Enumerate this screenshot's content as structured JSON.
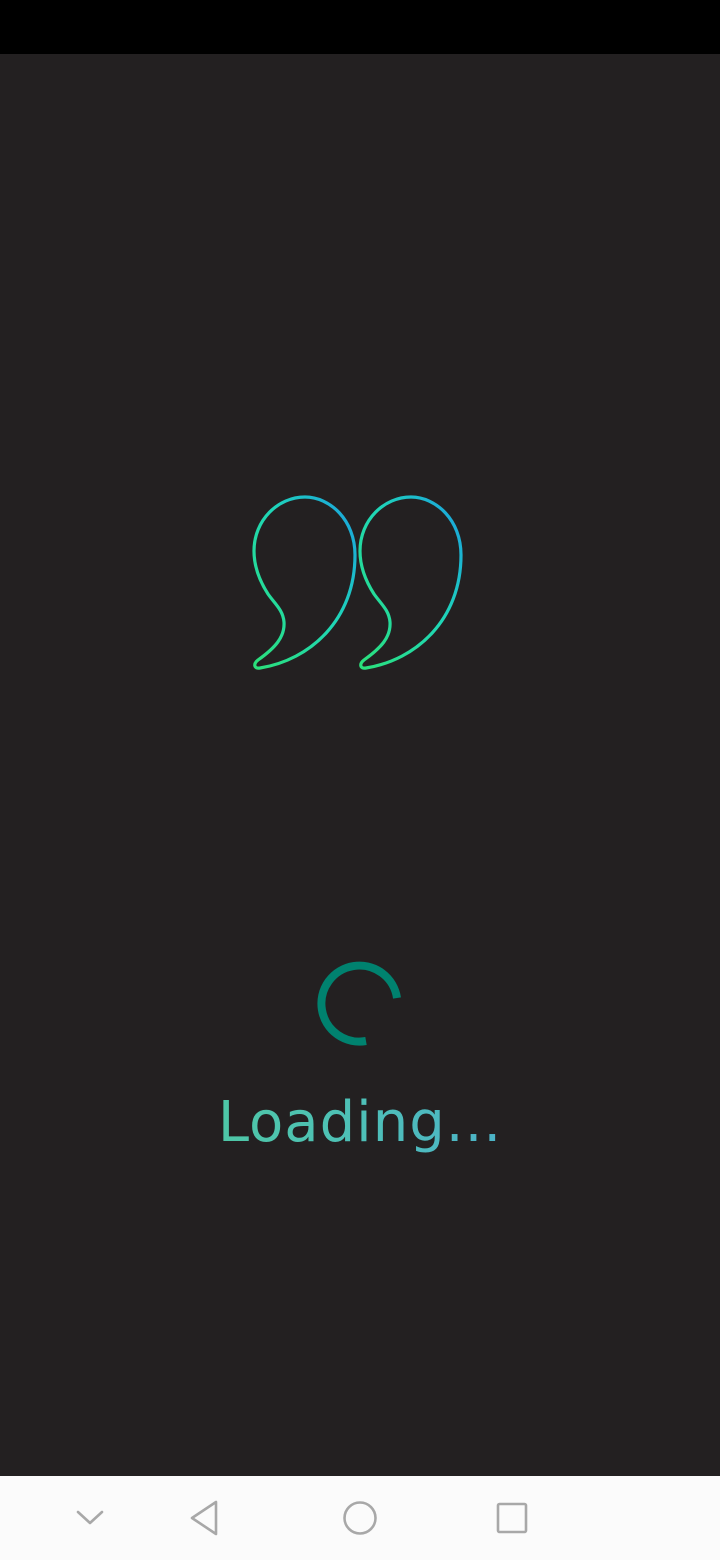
{
  "loading": {
    "text": "Loading..."
  },
  "icons": {
    "logo": "double-quote-icon",
    "spinner": "loading-spinner-icon",
    "nav": [
      "chevron-down-icon",
      "back-triangle-icon",
      "home-circle-icon",
      "recents-square-icon"
    ]
  },
  "colors": {
    "background": "#232021",
    "status_bar": "#000000",
    "nav_bar": "#fbfbfb",
    "nav_icon": "#a8a8a8",
    "accent_green": "#2be07a",
    "accent_teal": "#1fd6b8",
    "accent_blue": "#1aa0e0",
    "spinner": "#00826f"
  }
}
